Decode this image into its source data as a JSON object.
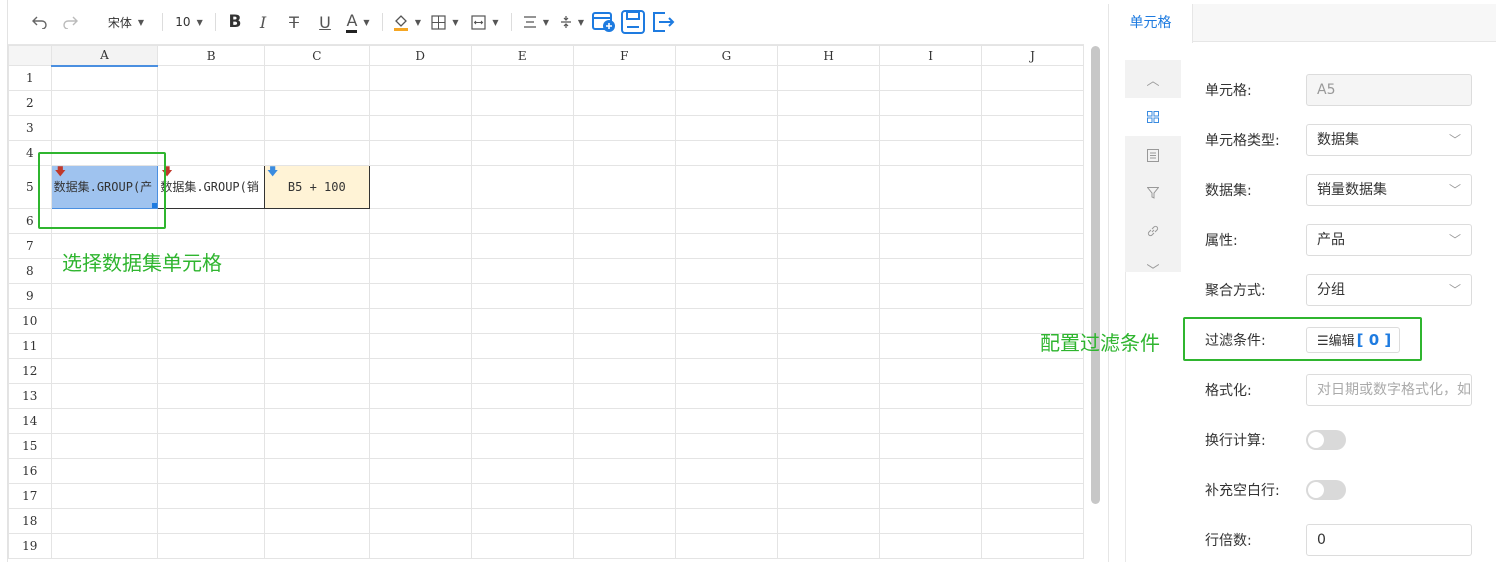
{
  "toolbar": {
    "font_family": "宋体",
    "font_size": "10",
    "bold": "B",
    "italic": "I",
    "strike": "T",
    "underline": "U",
    "font_color": "A"
  },
  "sheet": {
    "columns": [
      "A",
      "B",
      "C",
      "D",
      "E",
      "F",
      "G",
      "H",
      "I",
      "J"
    ],
    "rows": [
      "1",
      "2",
      "3",
      "4",
      "5",
      "6",
      "7",
      "8",
      "9",
      "10",
      "11",
      "12",
      "13",
      "14",
      "15",
      "16",
      "17",
      "18",
      "19"
    ],
    "cells": {
      "A5": "数据集.GROUP(产",
      "B5": "数据集.GROUP(销",
      "C5": "B5 + 100"
    }
  },
  "annotations": {
    "select_cell": "选择数据集单元格",
    "config_filter": "配置过滤条件"
  },
  "panel": {
    "tab": "单元格",
    "fields": {
      "cell_label": "单元格:",
      "cell_value": "A5",
      "cell_type_label": "单元格类型:",
      "cell_type_value": "数据集",
      "dataset_label": "数据集:",
      "dataset_value": "销量数据集",
      "attr_label": "属性:",
      "attr_value": "产品",
      "agg_label": "聚合方式:",
      "agg_value": "分组",
      "filter_label": "过滤条件:",
      "filter_btn": "☰编辑",
      "filter_count": "[ 0 ]",
      "format_label": "格式化:",
      "format_placeholder": "对日期或数字格式化，如",
      "wrap_calc_label": "换行计算:",
      "fill_blank_label": "补充空白行:",
      "row_multiple_label": "行倍数:",
      "row_multiple_value": "0"
    }
  },
  "colors": {
    "accent": "#1e7be0",
    "annotation": "#2fb52f",
    "selected_cell": "#9fc3ef",
    "formula_cell": "#fff3d6"
  }
}
